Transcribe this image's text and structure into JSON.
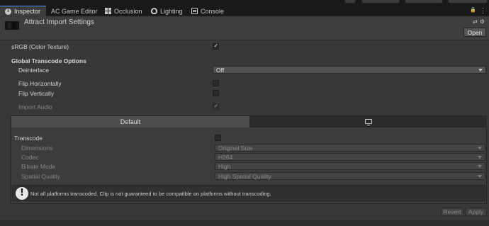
{
  "tabs": [
    {
      "label": "Inspector",
      "icon": "info-icon",
      "active": true
    },
    {
      "label": "AC Game Editor",
      "icon": "grid-icon",
      "active": false
    },
    {
      "label": "Occlusion",
      "icon": "grid-icon",
      "active": false
    },
    {
      "label": "Lighting",
      "icon": "bulb-icon",
      "active": false
    },
    {
      "label": "Console",
      "icon": "console-icon",
      "active": false
    }
  ],
  "tab_tools": {
    "lock": "🔒",
    "menu": "⋮"
  },
  "header": {
    "title": "Attract Import Settings",
    "open_label": "Open",
    "tools": {
      "settings": "⚙",
      "help": "⇄"
    }
  },
  "settings": {
    "srgb_label": "sRGB (Color Texture)",
    "srgb_checked": true,
    "global_section_label": "Global Transcode Options",
    "deinterlace_label": "Deinterlace",
    "deinterlace_value": "Off",
    "flip_h_label": "Flip Horizontally",
    "flip_v_label": "Flip Vertically",
    "import_audio_label": "Import Audio",
    "import_audio_checked": true
  },
  "platform": {
    "default_tab": "Default",
    "standalone_icon": "monitor-icon",
    "transcode_label": "Transcode",
    "dimensions_label": "Dimensions",
    "dimensions_value": "Original Size",
    "codec_label": "Codec",
    "codec_value": "H264",
    "bitrate_label": "Bitrate Mode",
    "bitrate_value": "High",
    "spatial_label": "Spatial Quality",
    "spatial_value": "High Spatial Quality"
  },
  "help": {
    "text": "Not all platforms transcoded. Clip is not guaranteed to be compatible on platforms without transcoding."
  },
  "footer": {
    "revert": "Revert",
    "apply": "Apply"
  },
  "colors": {
    "accent": "#4a8af4",
    "panel": "#383838",
    "tabbar": "#191919"
  }
}
